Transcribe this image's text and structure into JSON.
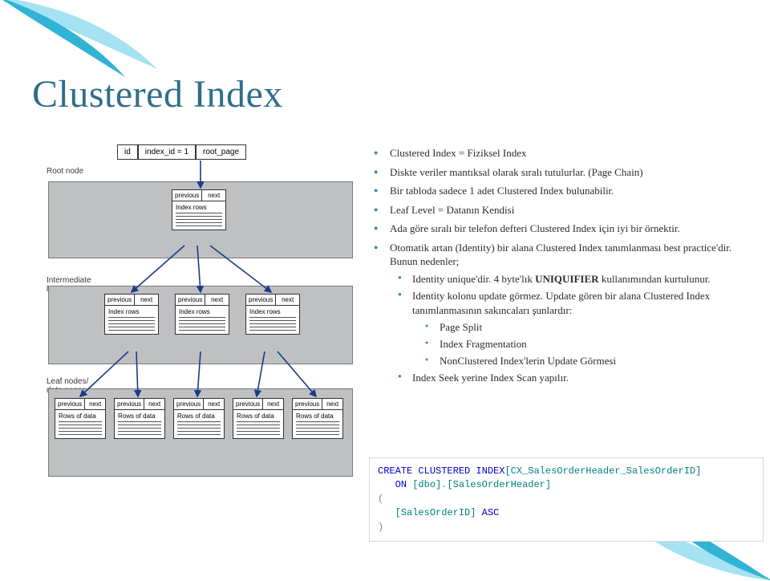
{
  "title": "Clustered Index",
  "diagram": {
    "top_boxes": {
      "id": "id",
      "index_id": "index_id = 1",
      "root_page": "root_page"
    },
    "levels": {
      "root": {
        "label": "Root node",
        "page_header_prev": "previous",
        "page_header_next": "next",
        "page_body": "Index rows"
      },
      "mid": {
        "label": "Intermediate level",
        "page_header_prev": "previous",
        "page_header_next": "next",
        "page_body": "Index rows"
      },
      "leaf": {
        "label": "Leaf nodes/ data pages",
        "page_header_prev": "previous",
        "page_header_next": "next",
        "page_body": "Rows of data"
      }
    }
  },
  "bullets": {
    "b1": "Clustered Index = Fiziksel Index",
    "b2": "Diskte veriler mantıksal olarak sıralı tutulurlar. (Page Chain)",
    "b3": "Bir tabloda sadece 1 adet Clustered Index bulunabilir.",
    "b4": "Leaf Level = Datanın Kendisi",
    "b5": "Ada göre sıralı bir telefon defteri Clustered Index için iyi bir örnektir.",
    "b6": "Otomatik artan (Identity) bir alana Clustered Index tanımlanması best practice'dir. Bunun nedenler;",
    "s1a": "Identity unique'dir. 4 byte'lık ",
    "s1b": "UNIQUIFIER",
    "s1c": " kullanımından kurtulunur.",
    "s2": "Identity kolonu update görmez. Update gören bir alana Clustered Index tanımlanmasının sakıncaları şunlardır:",
    "ss1": "Page Split",
    "ss2": "Index Fragmentation",
    "ss3": "NonClustered Index'lerin Update Görmesi",
    "s3": "Index Seek yerine Index Scan yapılır."
  },
  "code": {
    "create": "CREATE",
    "clustered_index": "CLUSTERED INDEX",
    "ix_name": "[CX_SalesOrderHeader_SalesOrderID]",
    "on": "ON",
    "schema": "[dbo]",
    "dot": ".",
    "table": "[SalesOrderHeader]",
    "lparen": "(",
    "col": "[SalesOrderID]",
    "asc": "ASC",
    "rparen": ")"
  }
}
